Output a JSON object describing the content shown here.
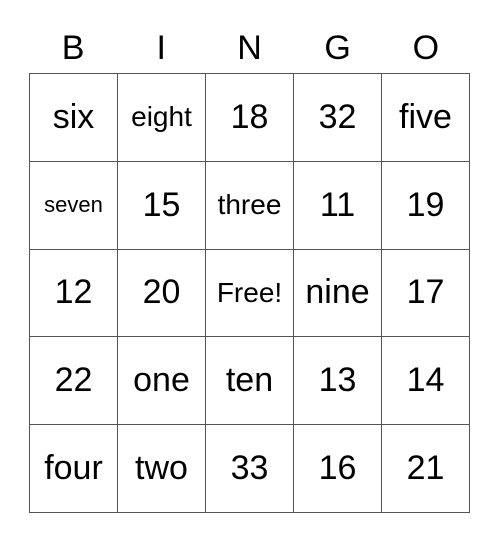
{
  "header": [
    "B",
    "I",
    "N",
    "G",
    "O"
  ],
  "cells": [
    [
      "six",
      "eight",
      "18",
      "32",
      "five"
    ],
    [
      "seven",
      "15",
      "three",
      "11",
      "19"
    ],
    [
      "12",
      "20",
      "Free!",
      "nine",
      "17"
    ],
    [
      "22",
      "one",
      "ten",
      "13",
      "14"
    ],
    [
      "four",
      "two",
      "33",
      "16",
      "21"
    ]
  ]
}
